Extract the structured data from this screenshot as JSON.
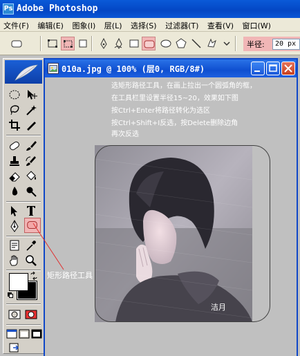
{
  "app": {
    "title": "Adobe Photoshop",
    "logo_letters": "Ps"
  },
  "menu": [
    "文件(F)",
    "编辑(E)",
    "图象(I)",
    "层(L)",
    "选择(S)",
    "过滤器(T)",
    "查看(V)",
    "窗口(W)"
  ],
  "options_bar": {
    "radius_label": "半径:",
    "radius_value": "20 px"
  },
  "document": {
    "title": "010a.jpg @ 100% (层0, RGB/8#)"
  },
  "instructions": [
    "选矩形路径工具，在画上拉出一个圆弧角的框，",
    "在工具栏里设置半径15~20，效果如下图",
    "按Ctrl+Enter将路径转化为选区",
    "按Ctrl+Shift+I反选，按Delete删除边角",
    "再次反选"
  ],
  "photo_signature": "洁月",
  "annotation": "矩形路径工具",
  "colors": {
    "highlight": "#f1b6b6",
    "xp_blue": "#0a56d6",
    "annotation_line": "#e03030"
  }
}
